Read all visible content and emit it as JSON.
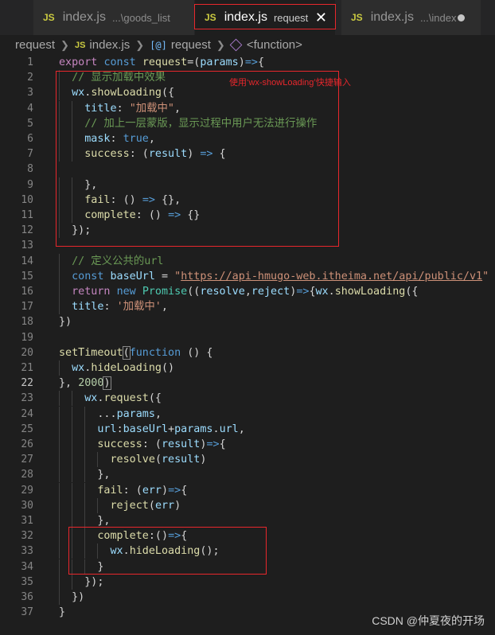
{
  "tabs": [
    {
      "badge": "JS",
      "name": "index.js",
      "desc": "...\\goods_list"
    },
    {
      "badge": "JS",
      "name": "index.js",
      "desc": "request",
      "close": "✕"
    },
    {
      "badge": "JS",
      "name": "index.js",
      "desc": "...\\index"
    }
  ],
  "breadcrumb": {
    "folder": "request",
    "file_badge": "JS",
    "file": "index.js",
    "var_icon": "[@]",
    "variable": "request",
    "function": "<function>"
  },
  "annotation": "使用‘wx-showLoading’快捷输入",
  "watermark": "CSDN @仲夏夜的开场",
  "current_line": 22,
  "lines": [
    [
      [
        "t-kw2",
        "export"
      ],
      [
        "t-p",
        " "
      ],
      [
        "t-kw",
        "const"
      ],
      [
        "t-p",
        " "
      ],
      [
        "t-fn",
        "request"
      ],
      [
        "t-p",
        "=("
      ],
      [
        "t-id",
        "params"
      ],
      [
        "t-p",
        ")"
      ],
      [
        "t-kw",
        "=>"
      ],
      [
        "t-p",
        "{"
      ]
    ],
    [
      [
        "t-p",
        "  "
      ],
      [
        "t-cm",
        "// 显示加载中效果"
      ]
    ],
    [
      [
        "t-p",
        "  "
      ],
      [
        "t-id",
        "wx"
      ],
      [
        "t-p",
        "."
      ],
      [
        "t-fn",
        "showLoading"
      ],
      [
        "t-p",
        "({"
      ]
    ],
    [
      [
        "t-p",
        "    "
      ],
      [
        "t-id",
        "title"
      ],
      [
        "t-p",
        ": "
      ],
      [
        "t-str",
        "\"加载中\""
      ],
      [
        "t-p",
        ","
      ]
    ],
    [
      [
        "t-p",
        "    "
      ],
      [
        "t-cm",
        "// 加上一层蒙版，显示过程中用户无法进行操作"
      ]
    ],
    [
      [
        "t-p",
        "    "
      ],
      [
        "t-id",
        "mask"
      ],
      [
        "t-p",
        ": "
      ],
      [
        "t-kw",
        "true"
      ],
      [
        "t-p",
        ","
      ]
    ],
    [
      [
        "t-p",
        "    "
      ],
      [
        "t-fn",
        "success"
      ],
      [
        "t-p",
        ": ("
      ],
      [
        "t-id",
        "result"
      ],
      [
        "t-p",
        ") "
      ],
      [
        "t-kw",
        "=>"
      ],
      [
        "t-p",
        " {"
      ]
    ],
    [
      [
        "t-p",
        ""
      ]
    ],
    [
      [
        "t-p",
        "    },"
      ]
    ],
    [
      [
        "t-p",
        "    "
      ],
      [
        "t-fn",
        "fail"
      ],
      [
        "t-p",
        ": () "
      ],
      [
        "t-kw",
        "=>"
      ],
      [
        "t-p",
        " {},"
      ]
    ],
    [
      [
        "t-p",
        "    "
      ],
      [
        "t-fn",
        "complete"
      ],
      [
        "t-p",
        ": () "
      ],
      [
        "t-kw",
        "=>"
      ],
      [
        "t-p",
        " {}"
      ]
    ],
    [
      [
        "t-p",
        "  });"
      ]
    ],
    [
      [
        "t-p",
        ""
      ]
    ],
    [
      [
        "t-p",
        "  "
      ],
      [
        "t-cm",
        "// 定义公共的url"
      ]
    ],
    [
      [
        "t-p",
        "  "
      ],
      [
        "t-kw",
        "const"
      ],
      [
        "t-p",
        " "
      ],
      [
        "t-id",
        "baseUrl"
      ],
      [
        "t-p",
        " = "
      ],
      [
        "t-str",
        "\""
      ],
      [
        "t-url",
        "https://api-hmugo-web.itheima.net/api/public/v1"
      ],
      [
        "t-str",
        "\""
      ]
    ],
    [
      [
        "t-p",
        "  "
      ],
      [
        "t-kw2",
        "return"
      ],
      [
        "t-p",
        " "
      ],
      [
        "t-kw",
        "new"
      ],
      [
        "t-p",
        " "
      ],
      [
        "t-cls",
        "Promise"
      ],
      [
        "t-p",
        "(("
      ],
      [
        "t-id",
        "resolve"
      ],
      [
        "t-p",
        ","
      ],
      [
        "t-id",
        "reject"
      ],
      [
        "t-p",
        ")"
      ],
      [
        "t-kw",
        "=>"
      ],
      [
        "t-p",
        "{"
      ],
      [
        "t-id",
        "wx"
      ],
      [
        "t-p",
        "."
      ],
      [
        "t-fn",
        "showLoading"
      ],
      [
        "t-p",
        "({"
      ]
    ],
    [
      [
        "t-p",
        "  "
      ],
      [
        "t-id",
        "title"
      ],
      [
        "t-p",
        ": "
      ],
      [
        "t-str",
        "'加载中'"
      ],
      [
        "t-p",
        ","
      ]
    ],
    [
      [
        "t-p",
        "})"
      ]
    ],
    [
      [
        "t-p",
        ""
      ]
    ],
    [
      [
        "t-fn",
        "setTimeout"
      ],
      [
        "bm",
        "("
      ],
      [
        "t-kw",
        "function"
      ],
      [
        "t-p",
        " () {"
      ]
    ],
    [
      [
        "t-p",
        "  "
      ],
      [
        "t-id",
        "wx"
      ],
      [
        "t-p",
        "."
      ],
      [
        "t-fn",
        "hideLoading"
      ],
      [
        "t-p",
        "()"
      ]
    ],
    [
      [
        "t-p",
        "}, "
      ],
      [
        "t-num",
        "2000"
      ],
      [
        "bm",
        ")"
      ]
    ],
    [
      [
        "t-p",
        "    "
      ],
      [
        "t-id",
        "wx"
      ],
      [
        "t-p",
        "."
      ],
      [
        "t-fn",
        "request"
      ],
      [
        "t-p",
        "({"
      ]
    ],
    [
      [
        "t-p",
        "      ..."
      ],
      [
        "t-id",
        "params"
      ],
      [
        "t-p",
        ","
      ]
    ],
    [
      [
        "t-p",
        "      "
      ],
      [
        "t-id",
        "url"
      ],
      [
        "t-p",
        ":"
      ],
      [
        "t-id",
        "baseUrl"
      ],
      [
        "t-p",
        "+"
      ],
      [
        "t-id",
        "params"
      ],
      [
        "t-p",
        "."
      ],
      [
        "t-id",
        "url"
      ],
      [
        "t-p",
        ","
      ]
    ],
    [
      [
        "t-p",
        "      "
      ],
      [
        "t-fn",
        "success"
      ],
      [
        "t-p",
        ": ("
      ],
      [
        "t-id",
        "result"
      ],
      [
        "t-p",
        ")"
      ],
      [
        "t-kw",
        "=>"
      ],
      [
        "t-p",
        "{"
      ]
    ],
    [
      [
        "t-p",
        "        "
      ],
      [
        "t-fn",
        "resolve"
      ],
      [
        "t-p",
        "("
      ],
      [
        "t-id",
        "result"
      ],
      [
        "t-p",
        ")"
      ]
    ],
    [
      [
        "t-p",
        "      },"
      ]
    ],
    [
      [
        "t-p",
        "      "
      ],
      [
        "t-fn",
        "fail"
      ],
      [
        "t-p",
        ": ("
      ],
      [
        "t-id",
        "err"
      ],
      [
        "t-p",
        ")"
      ],
      [
        "t-kw",
        "=>"
      ],
      [
        "t-p",
        "{"
      ]
    ],
    [
      [
        "t-p",
        "        "
      ],
      [
        "t-fn",
        "reject"
      ],
      [
        "t-p",
        "("
      ],
      [
        "t-id",
        "err"
      ],
      [
        "t-p",
        ")"
      ]
    ],
    [
      [
        "t-p",
        "      },"
      ]
    ],
    [
      [
        "t-p",
        "      "
      ],
      [
        "t-fn",
        "complete"
      ],
      [
        "t-p",
        ":()"
      ],
      [
        "t-kw",
        "=>"
      ],
      [
        "t-p",
        "{"
      ]
    ],
    [
      [
        "t-p",
        "        "
      ],
      [
        "t-id",
        "wx"
      ],
      [
        "t-p",
        "."
      ],
      [
        "t-fn",
        "hideLoading"
      ],
      [
        "t-p",
        "();"
      ]
    ],
    [
      [
        "t-p",
        "      }"
      ]
    ],
    [
      [
        "t-p",
        "    });"
      ]
    ],
    [
      [
        "t-p",
        "  })"
      ]
    ],
    [
      [
        "t-p",
        "}"
      ]
    ]
  ]
}
